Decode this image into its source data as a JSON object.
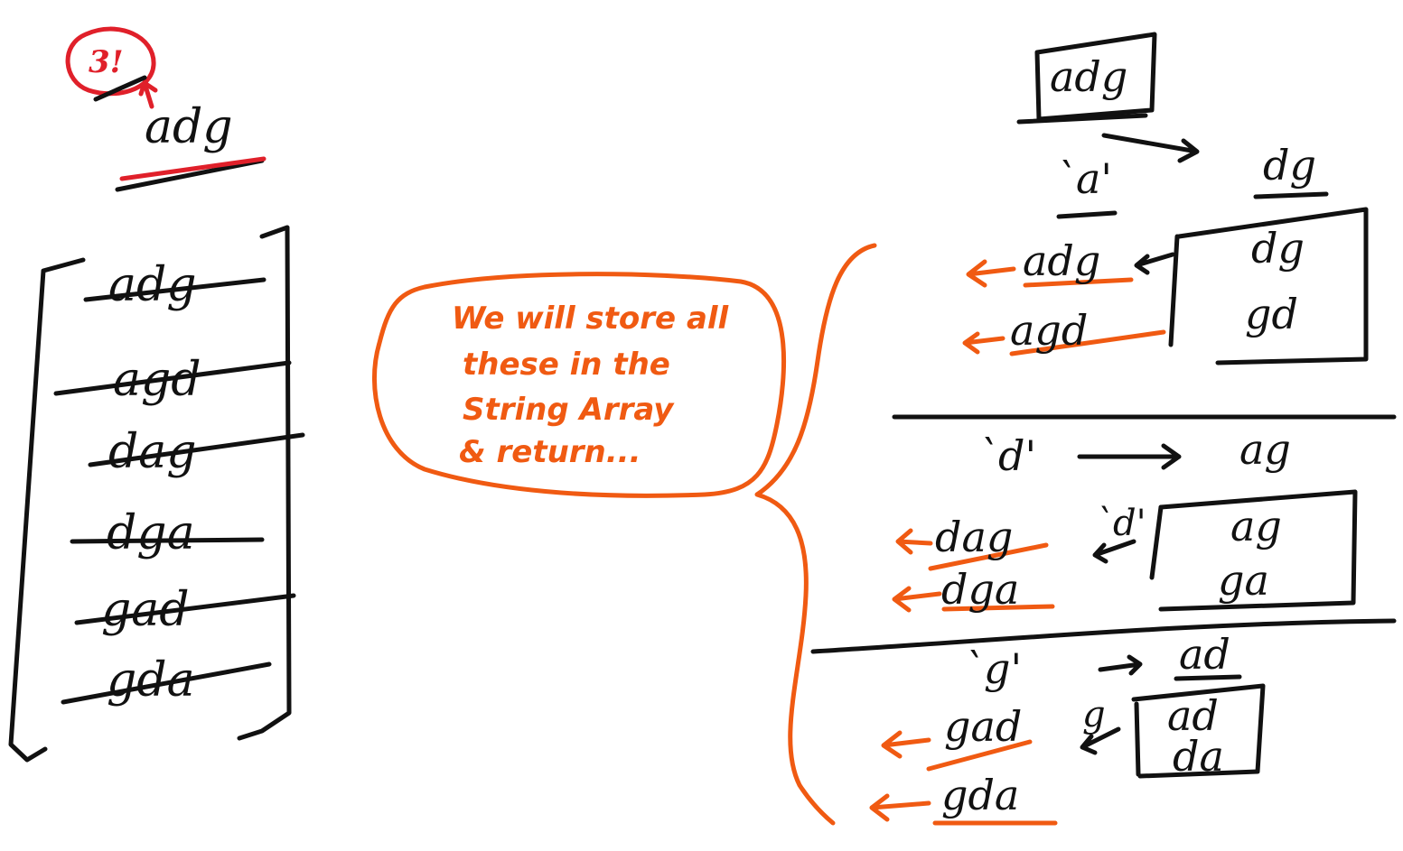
{
  "colors": {
    "ink": "#111111",
    "highlight": "#f05a12",
    "circle": "#e0202a"
  },
  "left": {
    "factorial_note": "3!",
    "input_word": "adg",
    "permutations": [
      "adg",
      "agd",
      "dag",
      "dga",
      "gad",
      "gda"
    ]
  },
  "note": {
    "lines": [
      "We will store all",
      "these in the",
      "String Array",
      "& return..."
    ]
  },
  "right": {
    "root_word": "adg",
    "branches": [
      {
        "char": "`a'",
        "rest": "dg",
        "sub": [
          "dg",
          "gd"
        ],
        "results": [
          "adg",
          "agd"
        ]
      },
      {
        "char": "`d'",
        "rest": "ag",
        "sub_label": "`d'",
        "sub": [
          "ag",
          "ga"
        ],
        "results": [
          "dag",
          "dga"
        ]
      },
      {
        "char": "`g'",
        "rest": "ad",
        "sub_label": "g",
        "sub": [
          "ad",
          "da"
        ],
        "results": [
          "gad",
          "gda"
        ]
      }
    ]
  }
}
